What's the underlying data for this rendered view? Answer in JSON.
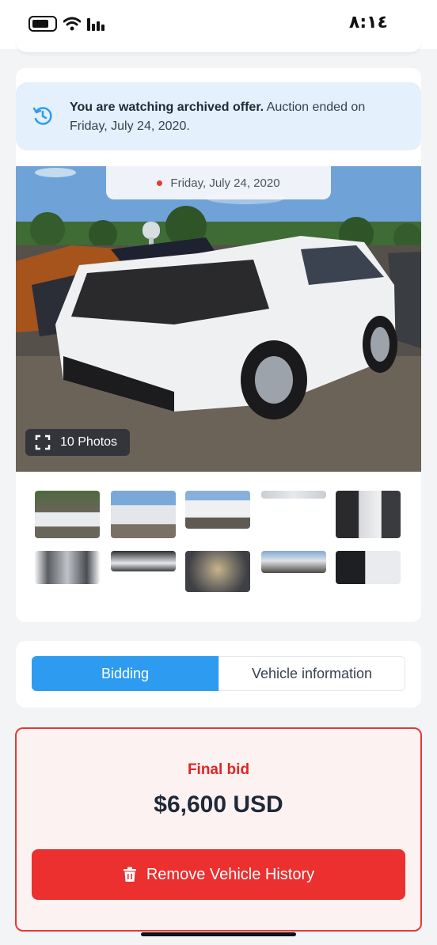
{
  "status": {
    "time": "٨:١٤",
    "icons": [
      "battery-icon",
      "wifi-icon",
      "signal-icon"
    ]
  },
  "notice": {
    "bold": "You are watching archived offer.",
    "rest": " Auction ended on Friday, July 24, 2020.",
    "icon": "history-icon"
  },
  "gallery": {
    "date": "Friday, July 24, 2020",
    "photos_count": "10 Photos",
    "thumbnail_count": 10
  },
  "tabs": [
    {
      "label": "Bidding",
      "active": true
    },
    {
      "label": "Vehicle information",
      "active": false
    }
  ],
  "bid": {
    "label": "Final bid",
    "amount": "$6,600 USD",
    "action": "Remove Vehicle History"
  },
  "colors": {
    "accent": "#2d9cf0",
    "danger": "#e53935",
    "notice_bg": "#e4f0fb"
  }
}
